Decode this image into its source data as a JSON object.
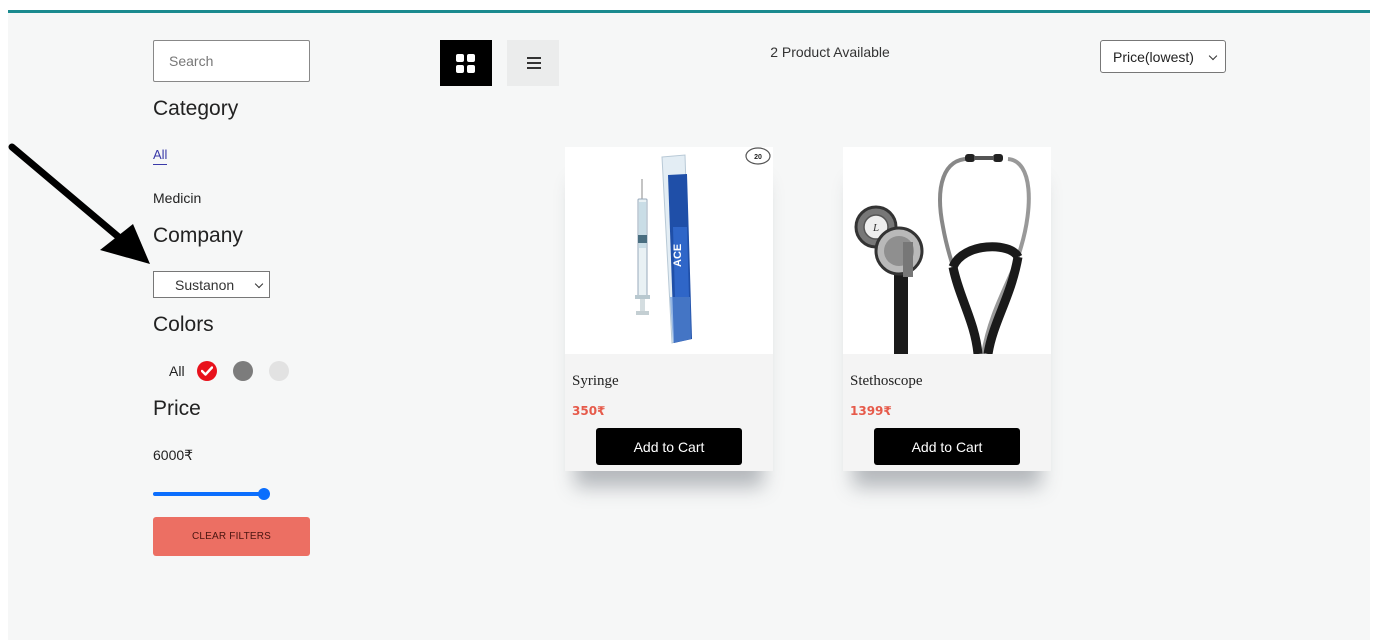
{
  "sidebar": {
    "search_placeholder": "Search",
    "category_heading": "Category",
    "categories": [
      "All",
      "Medicin"
    ],
    "company_heading": "Company",
    "company_selected": "Sustanon",
    "colors_heading": "Colors",
    "colors_all_label": "All",
    "colors": [
      {
        "hex": "#e8121c",
        "selected": true
      },
      {
        "hex": "#7c7c7c",
        "selected": false
      },
      {
        "hex": "#e2e2e2",
        "selected": false
      }
    ],
    "price_heading": "Price",
    "price_value": "6000₹",
    "price_slider_fraction": 1.0,
    "clear_label": "CLEAR FILTERS"
  },
  "toolbar": {
    "product_count": "2 Product Available",
    "sort_selected": "Price(lowest)",
    "grid_icon": "grid-view-icon",
    "list_icon": "list-view-icon"
  },
  "products": [
    {
      "name": "Syringe",
      "price": "350₹",
      "button": "Add to Cart",
      "badge": "20"
    },
    {
      "name": "Stethoscope",
      "price": "1399₹",
      "button": "Add to Cart"
    }
  ],
  "colors": {
    "accent_bar": "#1a8a8f",
    "price_text": "#e65a4a",
    "clear_button": "#ec6f63",
    "slider": "#0b6efd"
  }
}
